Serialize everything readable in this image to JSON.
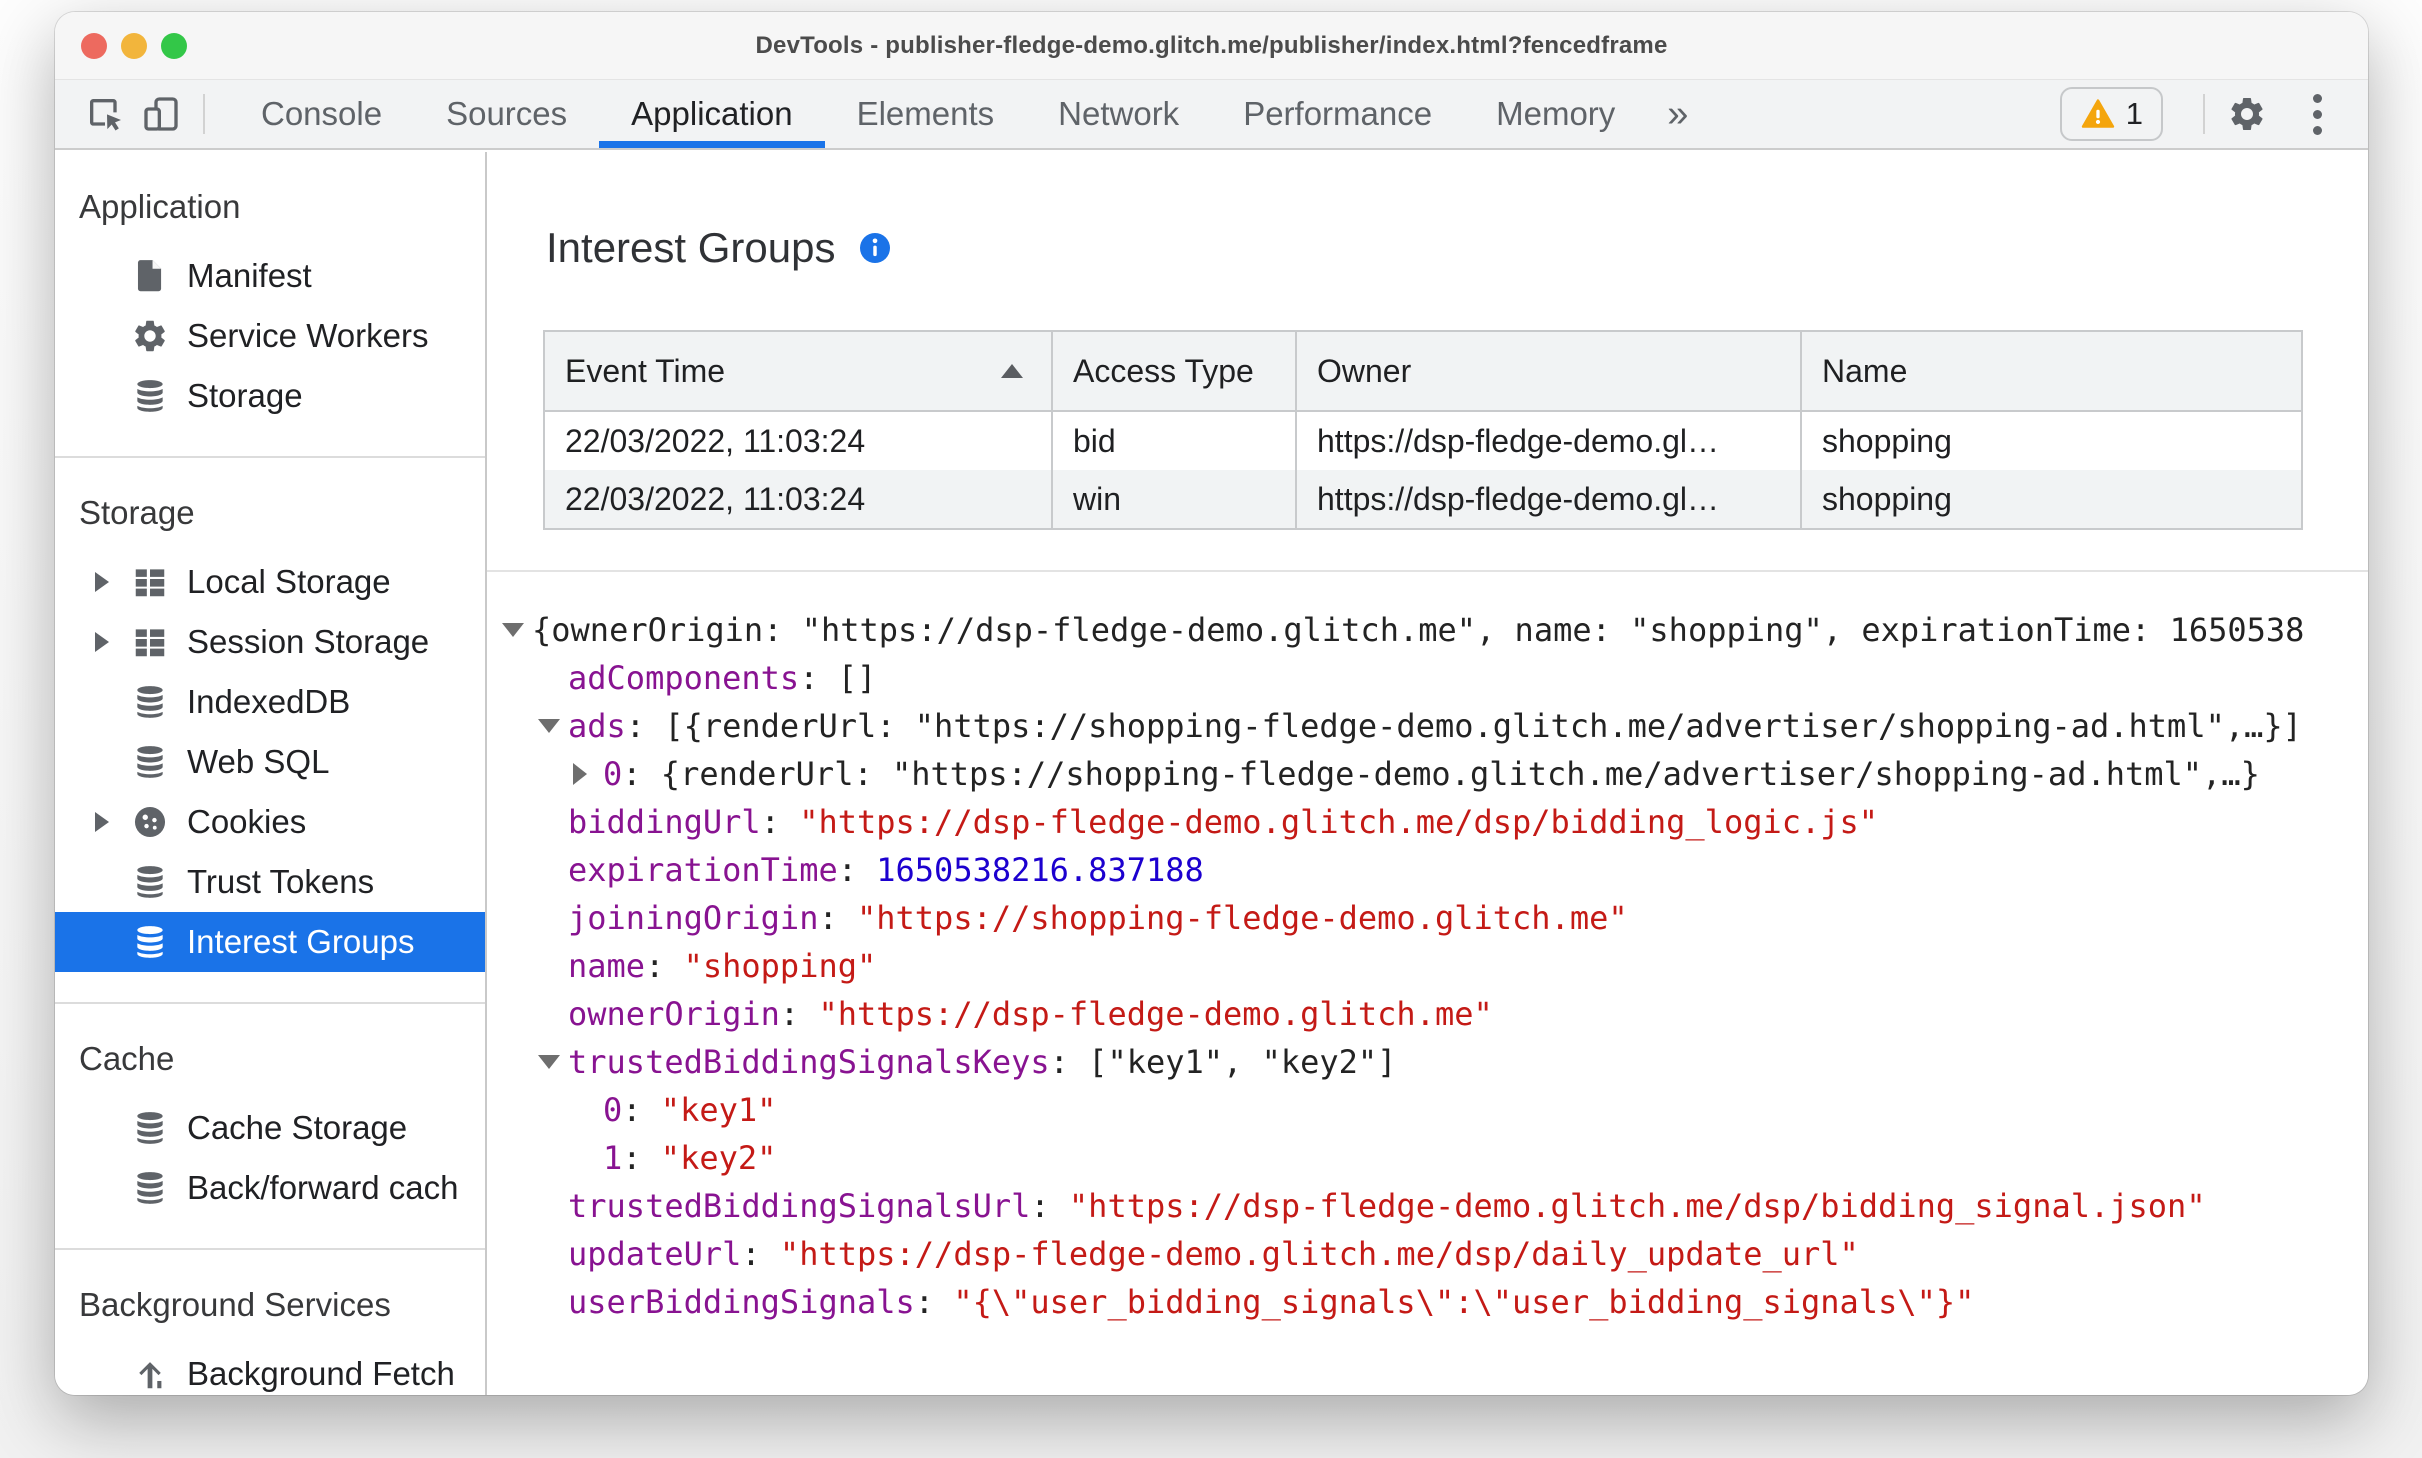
{
  "window": {
    "title": "DevTools - publisher-fledge-demo.glitch.me/publisher/index.html?fencedframe"
  },
  "toolbar": {
    "tabs": [
      {
        "label": "Console"
      },
      {
        "label": "Sources"
      },
      {
        "label": "Application",
        "selected": true
      },
      {
        "label": "Elements"
      },
      {
        "label": "Network"
      },
      {
        "label": "Performance"
      },
      {
        "label": "Memory"
      }
    ],
    "more_tabs_label": "»",
    "warning_count": "1"
  },
  "sidebar": {
    "sections": [
      {
        "title": "Application",
        "items": [
          {
            "label": "Manifest",
            "icon": "document-icon"
          },
          {
            "label": "Service Workers",
            "icon": "gear-icon"
          },
          {
            "label": "Storage",
            "icon": "database-icon"
          }
        ]
      },
      {
        "title": "Storage",
        "items": [
          {
            "label": "Local Storage",
            "icon": "table-icon",
            "expandable": true
          },
          {
            "label": "Session Storage",
            "icon": "table-icon",
            "expandable": true
          },
          {
            "label": "IndexedDB",
            "icon": "database-icon"
          },
          {
            "label": "Web SQL",
            "icon": "database-icon"
          },
          {
            "label": "Cookies",
            "icon": "cookie-icon",
            "expandable": true
          },
          {
            "label": "Trust Tokens",
            "icon": "database-icon"
          },
          {
            "label": "Interest Groups",
            "icon": "database-icon",
            "selected": true
          }
        ]
      },
      {
        "title": "Cache",
        "items": [
          {
            "label": "Cache Storage",
            "icon": "database-icon"
          },
          {
            "label": "Back/forward cach",
            "icon": "database-icon"
          }
        ]
      },
      {
        "title": "Background Services",
        "items": [
          {
            "label": "Background Fetch",
            "icon": "fetch-icon"
          }
        ]
      }
    ]
  },
  "main": {
    "title": "Interest Groups",
    "table": {
      "columns": [
        "Event Time",
        "Access Type",
        "Owner",
        "Name"
      ],
      "sort_column": "Event Time",
      "sort_direction": "ascending",
      "rows": [
        [
          "22/03/2022, 11:03:24",
          "bid",
          "https://dsp-fledge-demo.gl…",
          "shopping"
        ],
        [
          "22/03/2022, 11:03:24",
          "win",
          "https://dsp-fledge-demo.gl…",
          "shopping"
        ]
      ]
    },
    "tree": {
      "lines": [
        {
          "key": "",
          "sep": "",
          "value": "{ownerOrigin: \"https://dsp-fledge-demo.glitch.me\", name: \"shopping\", expirationTime: 1650538"
        },
        {
          "key": "adComponents",
          "sep": ": ",
          "value": "[]"
        },
        {
          "key": "ads",
          "sep": ": ",
          "value": "[{renderUrl: \"https://shopping-fledge-demo.glitch.me/advertiser/shopping-ad.html\",…}]"
        },
        {
          "key": "0",
          "sep": ": ",
          "value": "{renderUrl: \"https://shopping-fledge-demo.glitch.me/advertiser/shopping-ad.html\",…}"
        },
        {
          "key": "biddingUrl",
          "sep": ": ",
          "value": "\"https://dsp-fledge-demo.glitch.me/dsp/bidding_logic.js\""
        },
        {
          "key": "expirationTime",
          "sep": ": ",
          "value": "1650538216.837188"
        },
        {
          "key": "joiningOrigin",
          "sep": ": ",
          "value": "\"https://shopping-fledge-demo.glitch.me\""
        },
        {
          "key": "name",
          "sep": ": ",
          "value": "\"shopping\""
        },
        {
          "key": "ownerOrigin",
          "sep": ": ",
          "value": "\"https://dsp-fledge-demo.glitch.me\""
        },
        {
          "key": "trustedBiddingSignalsKeys",
          "sep": ": ",
          "value": "[\"key1\", \"key2\"]"
        },
        {
          "key": "0",
          "sep": ": ",
          "value": "\"key1\""
        },
        {
          "key": "1",
          "sep": ": ",
          "value": "\"key2\""
        },
        {
          "key": "trustedBiddingSignalsUrl",
          "sep": ": ",
          "value": "\"https://dsp-fledge-demo.glitch.me/dsp/bidding_signal.json\""
        },
        {
          "key": "updateUrl",
          "sep": ": ",
          "value": "\"https://dsp-fledge-demo.glitch.me/dsp/daily_update_url\""
        },
        {
          "key": "userBiddingSignals",
          "sep": ": ",
          "value": "\"{\\\"user_bidding_signals\\\":\\\"user_bidding_signals\\\"}\""
        }
      ]
    }
  },
  "colors": {
    "accent_blue": "#1a73e8",
    "key_purple": "#881391",
    "string_red": "#c41a16",
    "number_blue": "#1c00cf",
    "warning_amber": "#f4a50d",
    "traffic_red": "#ed6a5f",
    "traffic_yellow": "#f2b53c",
    "traffic_green": "#33c748"
  }
}
